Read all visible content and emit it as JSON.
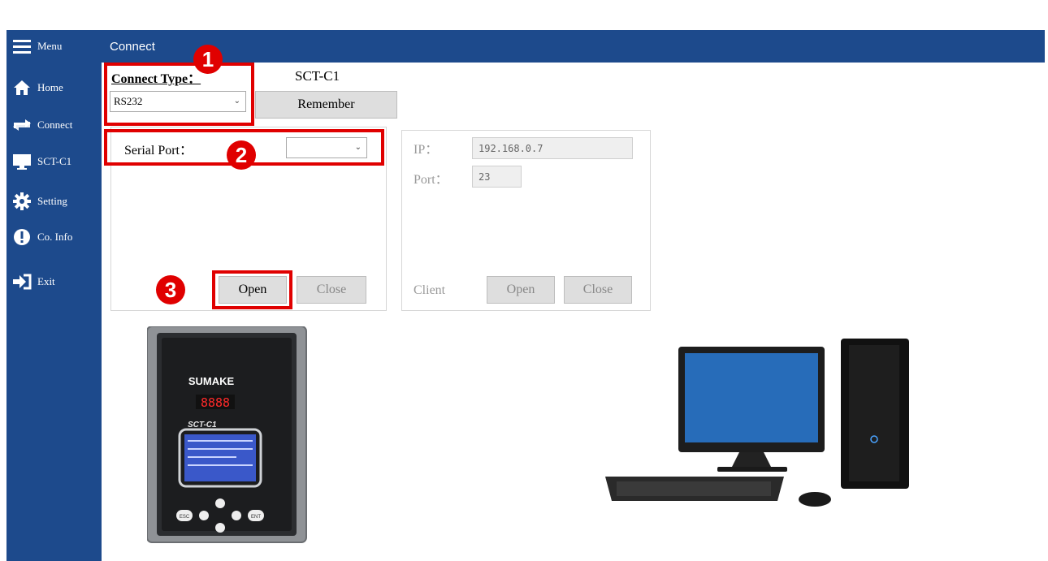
{
  "sidebar": {
    "items": [
      {
        "label": "Menu",
        "icon": "hamburger-icon"
      },
      {
        "label": "Home",
        "icon": "home-icon"
      },
      {
        "label": "Connect",
        "icon": "connect-arrows-icon"
      },
      {
        "label": "SCT-C1",
        "icon": "monitor-icon"
      },
      {
        "label": "Setting",
        "icon": "gear-icon"
      },
      {
        "label": "Co. Info",
        "icon": "info-exclamation-icon"
      },
      {
        "label": "Exit",
        "icon": "exit-icon"
      }
    ]
  },
  "header": {
    "title": "Connect"
  },
  "connect": {
    "type_label": "Connect Type：",
    "model": "SCT-C1",
    "type_value": "RS232",
    "remember_label": "Remember"
  },
  "serial": {
    "port_label": "Serial Port：",
    "port_value": "",
    "open_label": "Open",
    "close_label": "Close"
  },
  "network": {
    "ip_label": "IP：",
    "ip_value": "192.168.0.7",
    "port_label": "Port：",
    "port_value": "23",
    "client_label": "Client",
    "open_label": "Open",
    "close_label": "Close"
  },
  "device": {
    "brand": "SUMAKE",
    "display": "8888",
    "model_text": "SCT-C1",
    "esc": "ESC",
    "ent": "ENT"
  },
  "annotations": {
    "step1": "1",
    "step2": "2",
    "step3": "3"
  },
  "colors": {
    "sidebar": "#1d4a8c",
    "highlight": "#e00000",
    "button": "#dedede"
  }
}
